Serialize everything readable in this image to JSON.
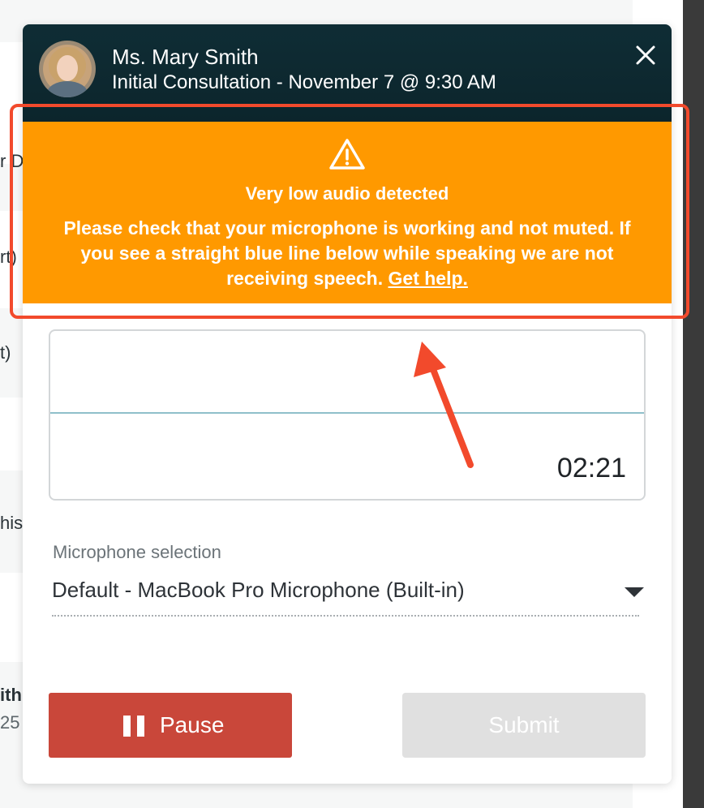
{
  "background": {
    "fragments": [
      "r D",
      "rt)",
      "t)",
      "his",
      "ith",
      "25"
    ]
  },
  "modal": {
    "patient_name": "Ms. Mary Smith",
    "appointment": "Initial Consultation - November 7 @ 9:30 AM",
    "close_icon": "close-icon"
  },
  "warning": {
    "icon": "warning-triangle-icon",
    "title": "Very low audio detected",
    "message": "Please check that your microphone is working and not muted. If you see a straight blue line below while speaking we are not receiving speech.",
    "link_label": "Get help.",
    "color": "#ff9900"
  },
  "recorder": {
    "timer": "02:21",
    "waveform_color": "#8fbfca"
  },
  "microphone": {
    "label": "Microphone selection",
    "selected": "Default - MacBook Pro Microphone (Built-in)"
  },
  "actions": {
    "pause_label": "Pause",
    "submit_label": "Submit",
    "pause_color": "#c9473a",
    "submit_disabled": true
  },
  "annotation": {
    "highlight_color": "#f24a2c"
  }
}
